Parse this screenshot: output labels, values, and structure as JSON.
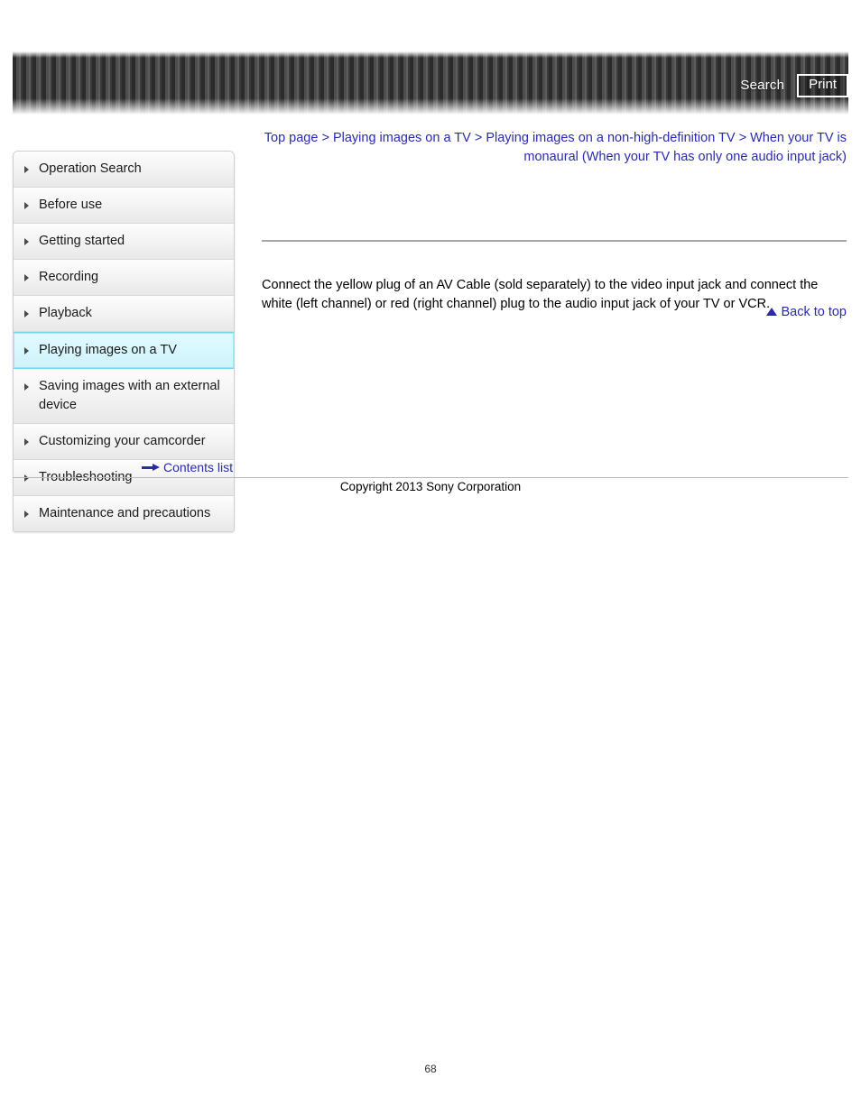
{
  "header": {
    "search_label": "Search",
    "print_label": "Print",
    "search_icon": "search-icon",
    "print_icon": "printer-icon"
  },
  "sidebar": {
    "items": [
      {
        "label": "Operation Search",
        "active": false
      },
      {
        "label": "Before use",
        "active": false
      },
      {
        "label": "Getting started",
        "active": false
      },
      {
        "label": "Recording",
        "active": false
      },
      {
        "label": "Playback",
        "active": false
      },
      {
        "label": "Playing images on a TV",
        "active": true
      },
      {
        "label": "Saving images with an external device",
        "active": false
      },
      {
        "label": "Customizing your camcorder",
        "active": false
      },
      {
        "label": "Troubleshooting",
        "active": false
      },
      {
        "label": "Maintenance and precautions",
        "active": false
      }
    ],
    "contents_list_label": "Contents list",
    "contents_list_icon": "arrow-right-icon"
  },
  "main": {
    "breadcrumb": "Top page > Playing images on a TV > Playing images on a non-high-definition TV > When your TV is monaural (When your TV has only one audio input jack)",
    "body": "Connect the yellow plug of an AV Cable (sold separately) to the video input jack and connect the white (left channel) or red (right channel) plug to the audio input jack of your TV or VCR.",
    "back_to_top_label": "Back to top",
    "back_to_top_icon": "triangle-up-icon"
  },
  "footer": {
    "copyright": "Copyright 2013 Sony Corporation",
    "page_number": "68"
  },
  "colors": {
    "link": "#2a2ab0",
    "active_nav_bg": "#d6f6fd",
    "active_nav_border": "#79d5ee",
    "header_dark": "#2b2b2b",
    "rule": "#a8a8a8"
  }
}
